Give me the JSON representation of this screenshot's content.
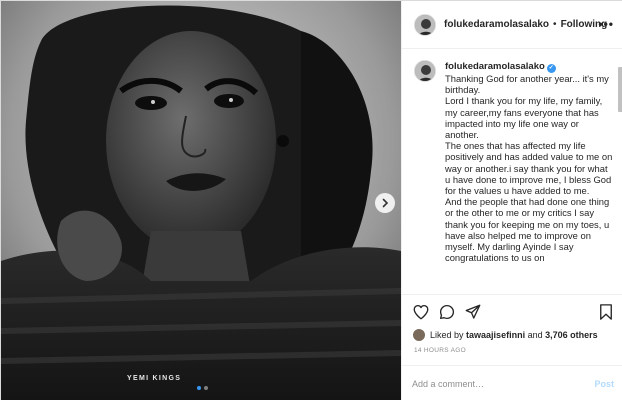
{
  "media": {
    "watermark": "YEMI KINGS",
    "carousel": {
      "count": 2,
      "active": 0
    }
  },
  "header": {
    "username": "folukedaramolasalako",
    "separator": "•",
    "follow_label": "Following",
    "more_label": "•••"
  },
  "caption": {
    "username": "folukedaramolasalako",
    "verified": true,
    "paragraphs": [
      "Thanking God for another year... it's my birthday.",
      "Lord I thank you for my life, my family, my career,my fans everyone that has impacted into my life one way or another.",
      "The ones that has affected my life positively and has added value to me on way or another.i say thank you for what u have done to improve me, I bless God for the values u have added to me.",
      "And the people that had done one thing or the other to me or my critics I say thank you for keeping me on my toes, u have also helped me to improve on myself. My darling Ayinde I say congratulations to us on"
    ]
  },
  "actions": {
    "icons": [
      "heart-icon",
      "comment-icon",
      "share-icon",
      "bookmark-icon"
    ]
  },
  "likes": {
    "prefix": "Liked by",
    "user": "tawaajisefinni",
    "connector": "and",
    "count_text": "3,706 others"
  },
  "timestamp": "14 HOURS AGO",
  "comment": {
    "placeholder": "Add a comment…",
    "post_label": "Post"
  },
  "colors": {
    "accent": "#3897f0",
    "post_disabled": "#b3dbff",
    "border": "#dbdbdb"
  }
}
